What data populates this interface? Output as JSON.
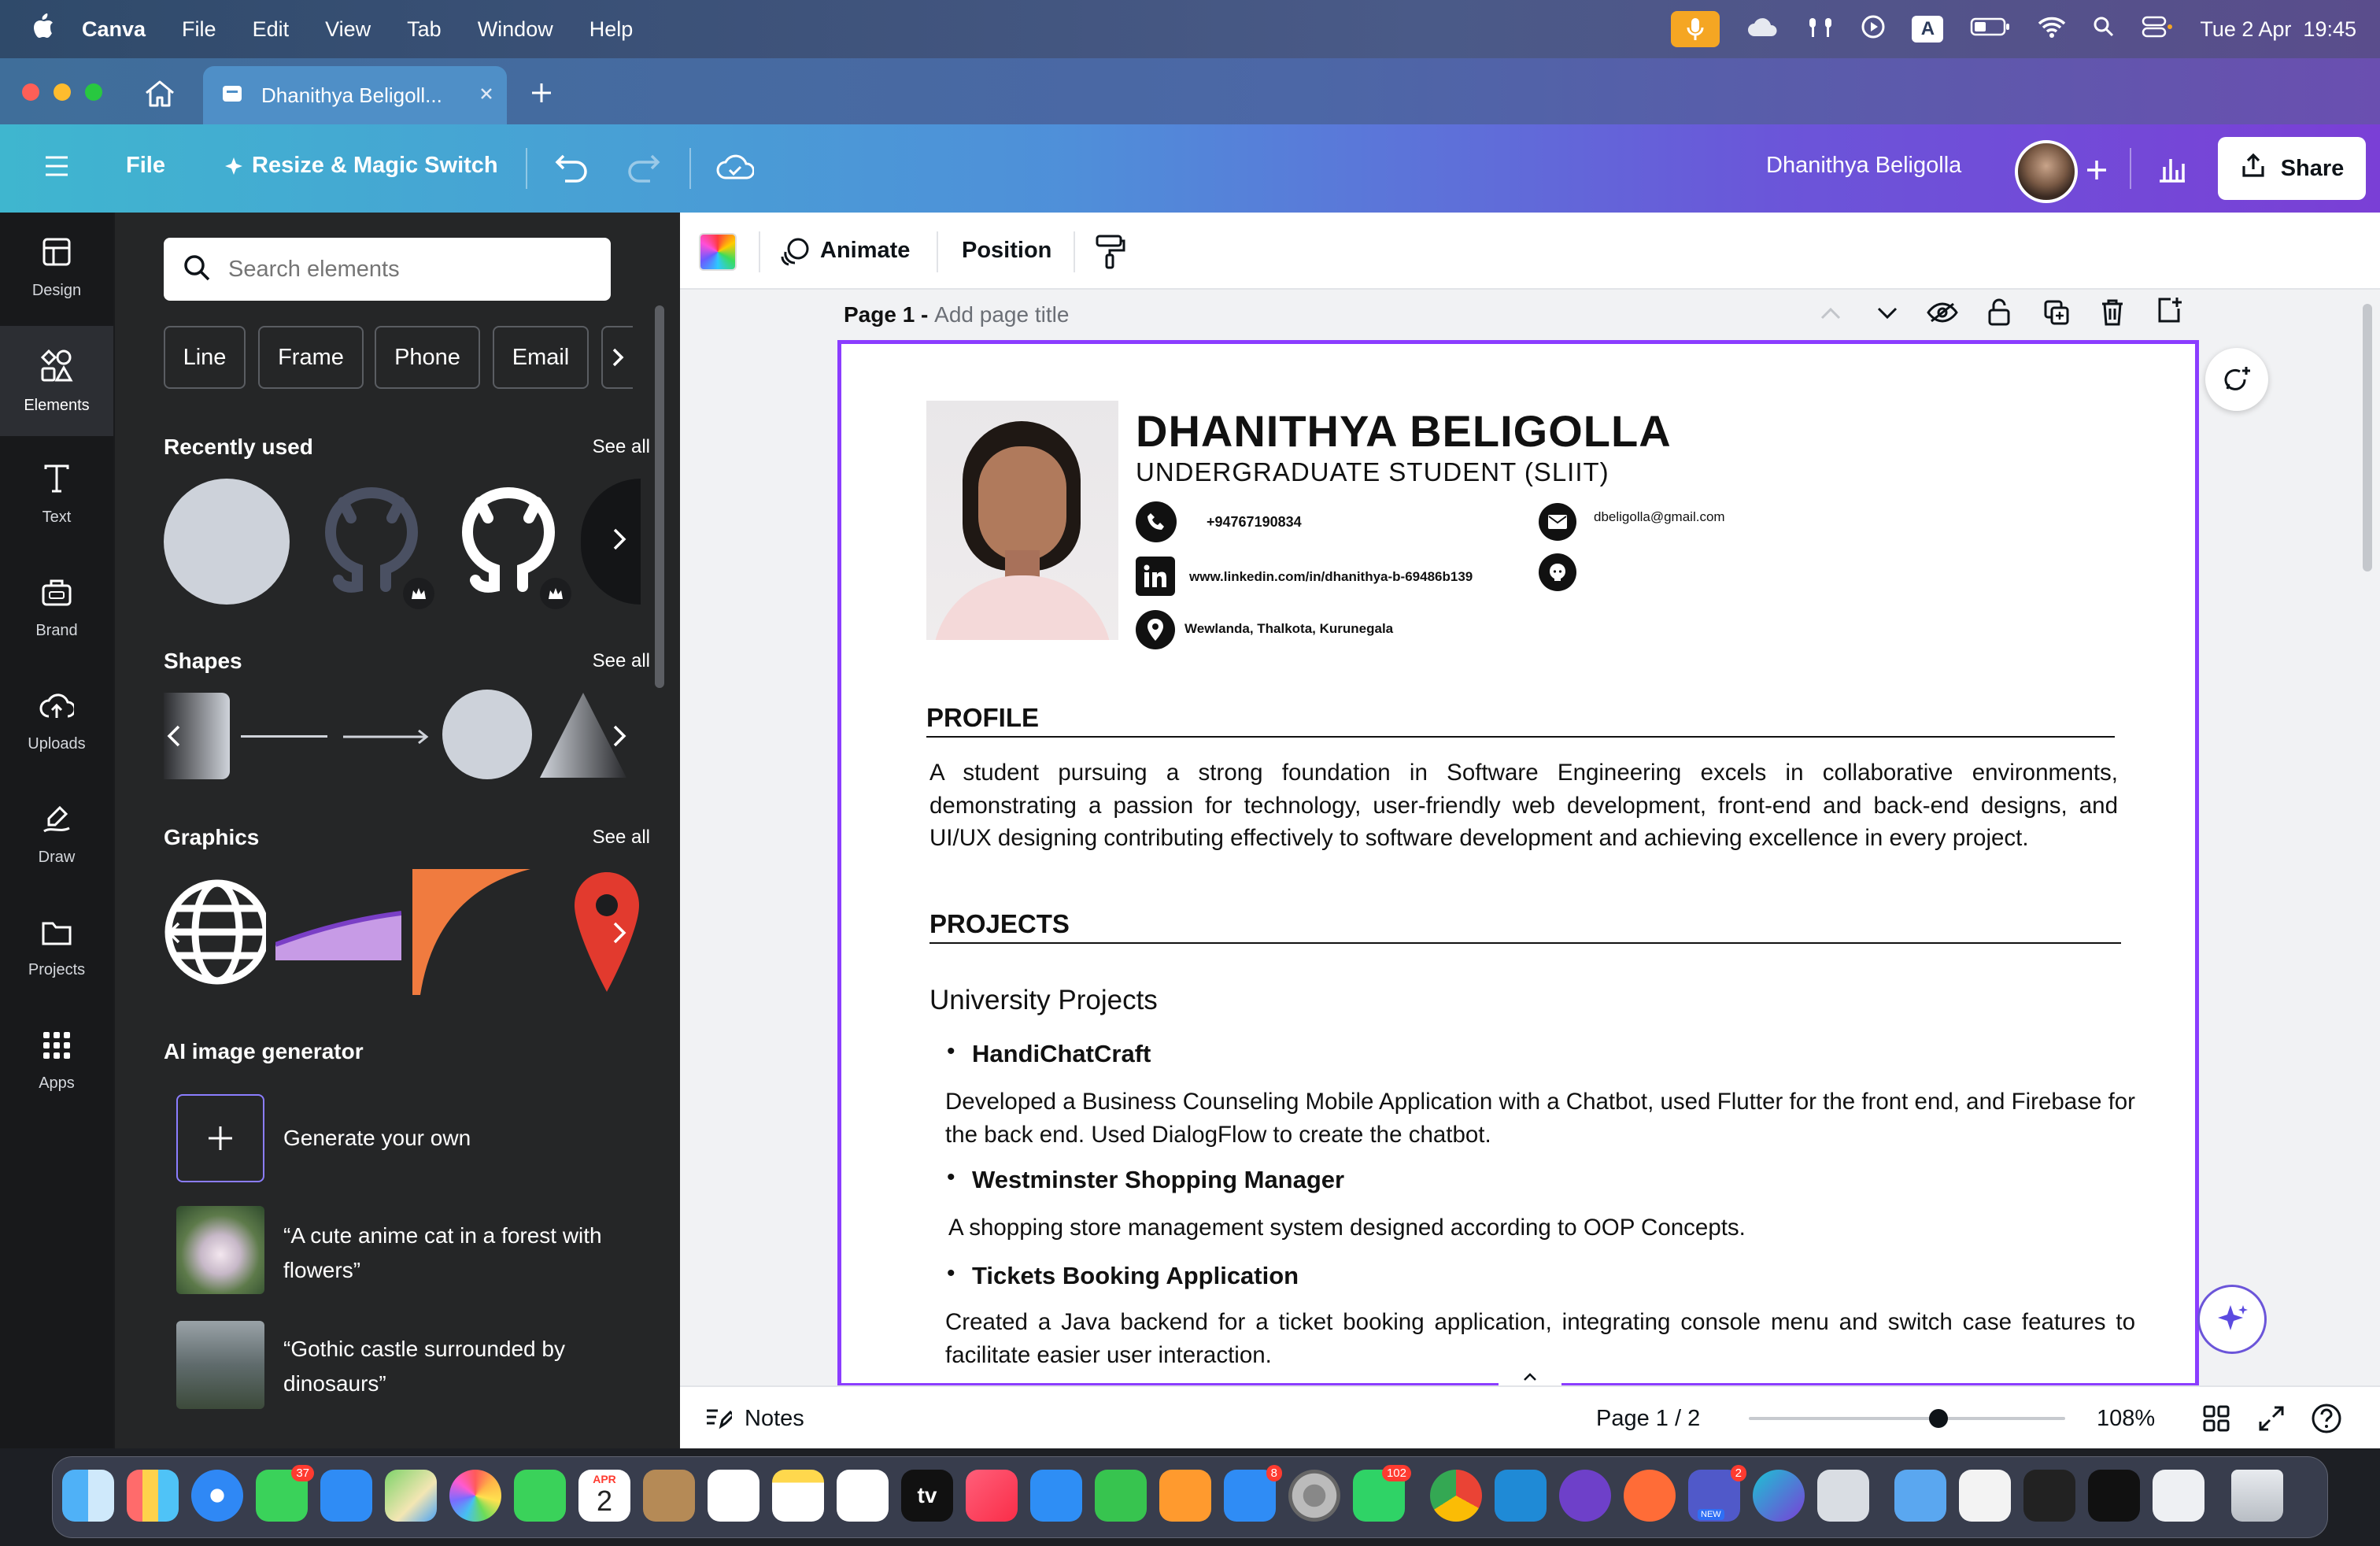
{
  "menubar": {
    "app": "Canva",
    "items": [
      "File",
      "Edit",
      "View",
      "Tab",
      "Window",
      "Help"
    ],
    "date_time": "Tue 2 Apr  19:45",
    "input_source": "A"
  },
  "tabs": {
    "active_title": "Dhanithya Beligoll..."
  },
  "toolbar": {
    "file": "File",
    "resize": "Resize & Magic Switch",
    "user_name": "Dhanithya Beligolla",
    "share": "Share"
  },
  "rail": [
    {
      "label": "Design",
      "icon": "design-icon"
    },
    {
      "label": "Elements",
      "icon": "elements-icon",
      "active": true
    },
    {
      "label": "Text",
      "icon": "text-icon"
    },
    {
      "label": "Brand",
      "icon": "brand-icon"
    },
    {
      "label": "Uploads",
      "icon": "uploads-icon"
    },
    {
      "label": "Draw",
      "icon": "draw-icon"
    },
    {
      "label": "Projects",
      "icon": "projects-icon"
    },
    {
      "label": "Apps",
      "icon": "apps-icon"
    }
  ],
  "panel": {
    "search_placeholder": "Search elements",
    "chips": [
      "Line",
      "Frame",
      "Phone",
      "Email"
    ],
    "recently_used": "Recently used",
    "shapes": "Shapes",
    "graphics": "Graphics",
    "see_all": "See all",
    "ai_title": "AI image generator",
    "ai_generate": "Generate your own",
    "ai_prompt_1": "“A cute anime cat in a forest with flowers”",
    "ai_prompt_2": "“Gothic castle surrounded by dinosaurs”"
  },
  "context_bar": {
    "animate": "Animate",
    "position": "Position"
  },
  "page": {
    "label_prefix": "Page 1 - ",
    "label_placeholder": "Add page title"
  },
  "resume": {
    "name": "DHANITHYA BELIGOLLA",
    "role": "UNDERGRADUATE STUDENT (SLIIT)",
    "phone": "+94767190834",
    "email": "dbeligolla@gmail.com",
    "linkedin": "www.linkedin.com/in/dhanithya-b-69486b139",
    "address": "Wewlanda, Thalkota, Kurunegala",
    "profile_heading": "PROFILE",
    "profile_text": "A student pursuing a strong foundation in Software Engineering excels in collaborative environments, demonstrating a passion for technology, user-friendly web development, front-end and back-end designs, and UI/UX designing contributing effectively to software development and achieving excellence in every project.",
    "projects_heading": "PROJECTS",
    "university_projects": "University Projects",
    "project_1_title": "HandiChatCraft",
    "project_1_desc": "Developed a Business Counseling Mobile Application with a Chatbot, used Flutter for the front end, and Firebase for the back end. Used DialogFlow to create the chatbot.",
    "project_2_title": "Westminster Shopping Manager",
    "project_2_desc": "A shopping store management system designed according to OOP Concepts.",
    "project_3_title": "Tickets Booking Application",
    "project_3_desc": "Created a Java backend for a ticket booking application, integrating console menu and switch case features to facilitate easier user interaction."
  },
  "bottom_bar": {
    "notes": "Notes",
    "page_indicator": "Page 1 / 2",
    "zoom": "108%",
    "zoom_fraction": 0.6
  },
  "dock": {
    "calendar_month": "APR",
    "calendar_day": "2",
    "messages_badge": "37",
    "appstore_badge": "8",
    "whatsapp_badge": "102",
    "teams_badge": "2",
    "teams_new": "NEW",
    "appletv": "tv"
  },
  "colors": {
    "accent": "#8b3dff",
    "panel_bg": "#252627",
    "rail_bg": "#18191b"
  }
}
